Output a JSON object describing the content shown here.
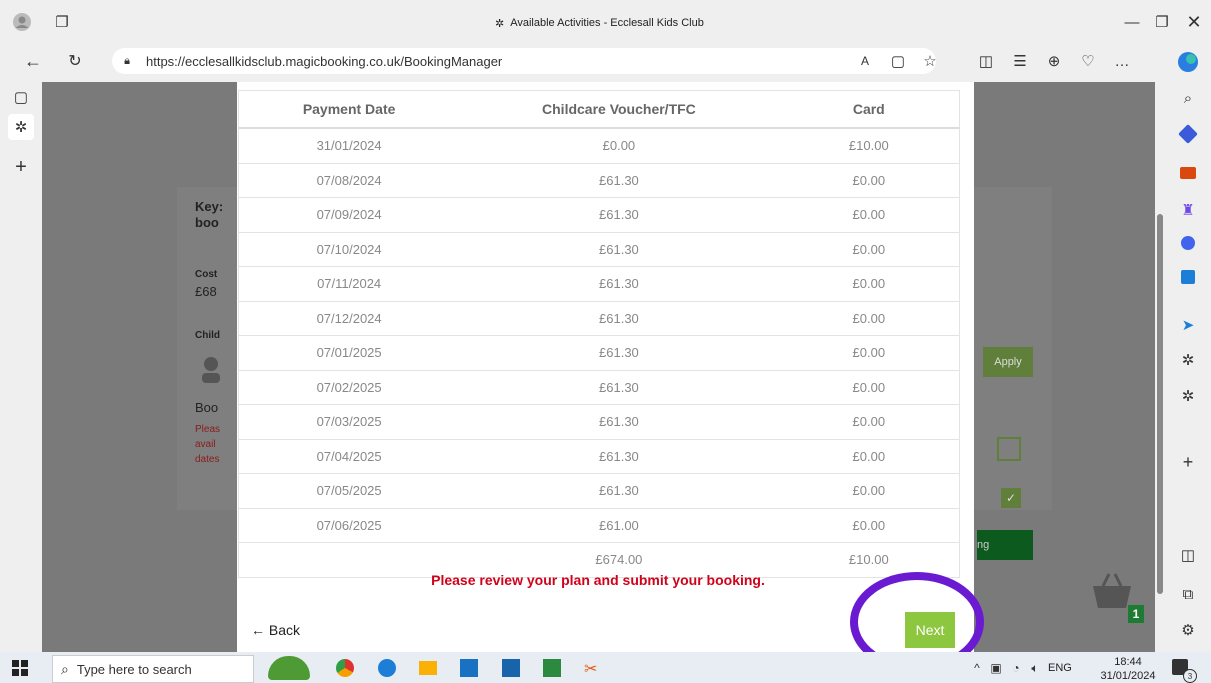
{
  "browser": {
    "tab_title": "Available Activities - Ecclesall Kids Club",
    "url": "https://ecclesallkidsclub.magicbooking.co.uk/BookingManager"
  },
  "background_card": {
    "heading_fragment": "Key: boo",
    "cost_label": "Cost",
    "cost_value": "£68",
    "child_label": "Child",
    "booking_fragment": "Boo",
    "warning_fragment": "Pleas avail dates",
    "apply_label": "Apply",
    "booking_button_fragment": "ng"
  },
  "table": {
    "headers": [
      "Payment Date",
      "Childcare Voucher/TFC",
      "Card"
    ],
    "rows": [
      [
        "31/01/2024",
        "£0.00",
        "£10.00"
      ],
      [
        "07/08/2024",
        "£61.30",
        "£0.00"
      ],
      [
        "07/09/2024",
        "£61.30",
        "£0.00"
      ],
      [
        "07/10/2024",
        "£61.30",
        "£0.00"
      ],
      [
        "07/11/2024",
        "£61.30",
        "£0.00"
      ],
      [
        "07/12/2024",
        "£61.30",
        "£0.00"
      ],
      [
        "07/01/2025",
        "£61.30",
        "£0.00"
      ],
      [
        "07/02/2025",
        "£61.30",
        "£0.00"
      ],
      [
        "07/03/2025",
        "£61.30",
        "£0.00"
      ],
      [
        "07/04/2025",
        "£61.30",
        "£0.00"
      ],
      [
        "07/05/2025",
        "£61.30",
        "£0.00"
      ],
      [
        "07/06/2025",
        "£61.00",
        "£0.00"
      ]
    ],
    "totals": [
      "",
      "£674.00",
      "£10.00"
    ]
  },
  "modal": {
    "review_message": "Please review your plan and submit your booking.",
    "back_label": "← Back",
    "next_label": "Next"
  },
  "basket_count": "1",
  "taskbar": {
    "search_placeholder": "Type here to search",
    "language": "ENG",
    "time": "18:44",
    "date": "31/01/2024",
    "notification_count": "3"
  },
  "colors": {
    "accent_green": "#8dc63f",
    "warning_red": "#d0021b",
    "annotation_purple": "#6a1bd1"
  }
}
